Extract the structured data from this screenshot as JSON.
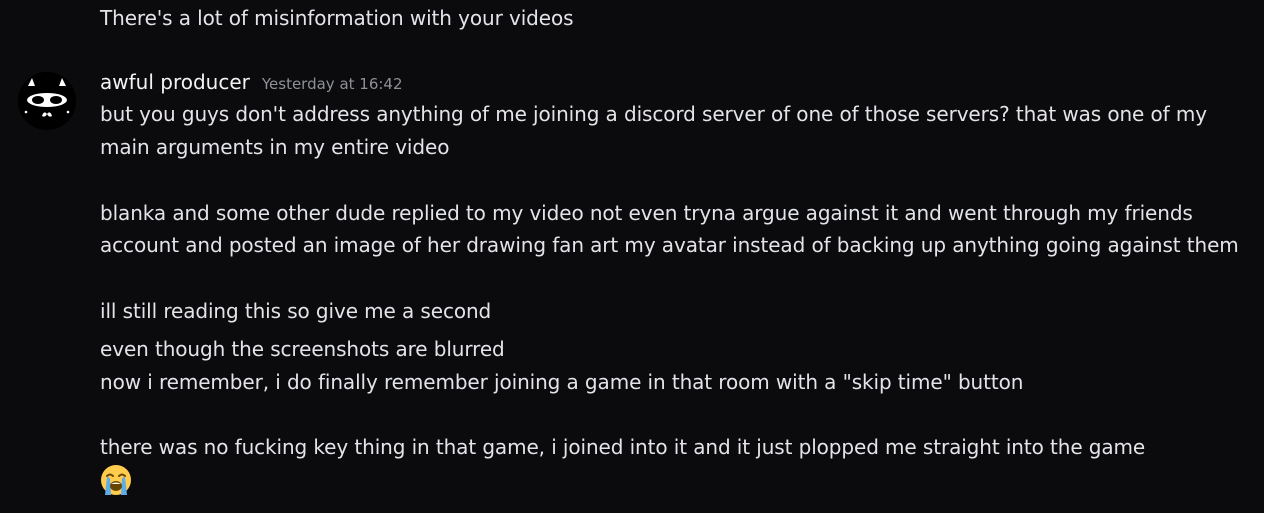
{
  "previous_message": {
    "text": "There's a lot of misinformation with your videos"
  },
  "message": {
    "author": "awful producer",
    "timestamp": "Yesterday at 16:42",
    "avatar_icon": "masked-face-avatar",
    "lines": [
      "but you guys don't address anything of me joining a discord server of one of those servers? that was one of my",
      "main arguments in my entire video",
      "blanka and some other dude replied to my video not even tryna argue against it and went through my friends",
      "account and posted an image of her drawing fan art my avatar instead of backing up anything going against them",
      "ill still reading this so give me a second",
      "even though the screenshots are blurred",
      "now i remember, i do finally remember joining a game in that room with a \"skip time\" button",
      "there was no fucking key thing in that game, i joined into it and it just plopped me straight into the game"
    ],
    "emoji": "loudly-crying-face"
  },
  "colors": {
    "background": "#0b0b0e",
    "text": "#e3e4e8",
    "timestamp": "#8e9096"
  }
}
